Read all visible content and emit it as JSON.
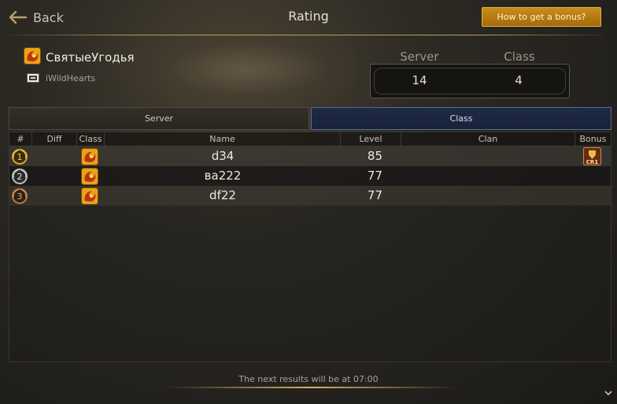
{
  "header": {
    "back_label": "Back",
    "title": "Rating",
    "bonus_button": "How to get a bonus?"
  },
  "player": {
    "name": "СвятыеУгодья",
    "account": "iWildHearts",
    "class_icon": "class-emblem-icon",
    "clan_icon": "clan-crest-icon"
  },
  "ranks": {
    "server_label": "Server",
    "class_label": "Class",
    "server_value": "14",
    "class_value": "4"
  },
  "tabs": [
    {
      "label": "Server",
      "active": false
    },
    {
      "label": "Class",
      "active": true
    }
  ],
  "table": {
    "columns": [
      "#",
      "Diff",
      "Class",
      "Name",
      "Level",
      "Clan",
      "Bonus"
    ],
    "rows": [
      {
        "rank": "1",
        "diff": "",
        "name": "d34",
        "level": "85",
        "clan": "",
        "bonus": "CR1"
      },
      {
        "rank": "2",
        "diff": "",
        "name": "ва222",
        "level": "77",
        "clan": "",
        "bonus": ""
      },
      {
        "rank": "3",
        "diff": "",
        "name": "df22",
        "level": "77",
        "clan": "",
        "bonus": ""
      }
    ]
  },
  "footer": {
    "next_results": "The next results will be at 07:00"
  },
  "colors": {
    "accent_gold": "#c98d1c",
    "active_tab": "#1f2a45",
    "medal_gold": "#d4a52a",
    "medal_silver": "#b8b8b8",
    "medal_bronze": "#b07840"
  }
}
